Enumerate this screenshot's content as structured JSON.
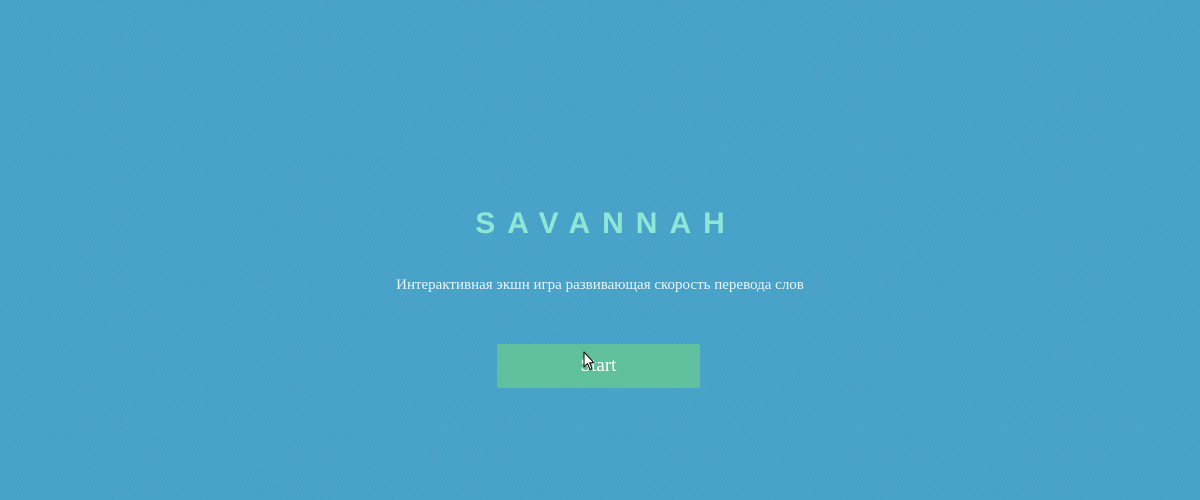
{
  "app": {
    "title": "SAVANNAH",
    "description": "Интерактивная экшн игра развивающая скорость перевода слов"
  },
  "actions": {
    "start_label": "Start"
  },
  "icons": {
    "cursor": "mouse-pointer-icon"
  },
  "colors": {
    "background": "#47a3c9",
    "title": "#8fe6d6",
    "button": "#5ebf9c",
    "text": "#e6f3f7"
  }
}
